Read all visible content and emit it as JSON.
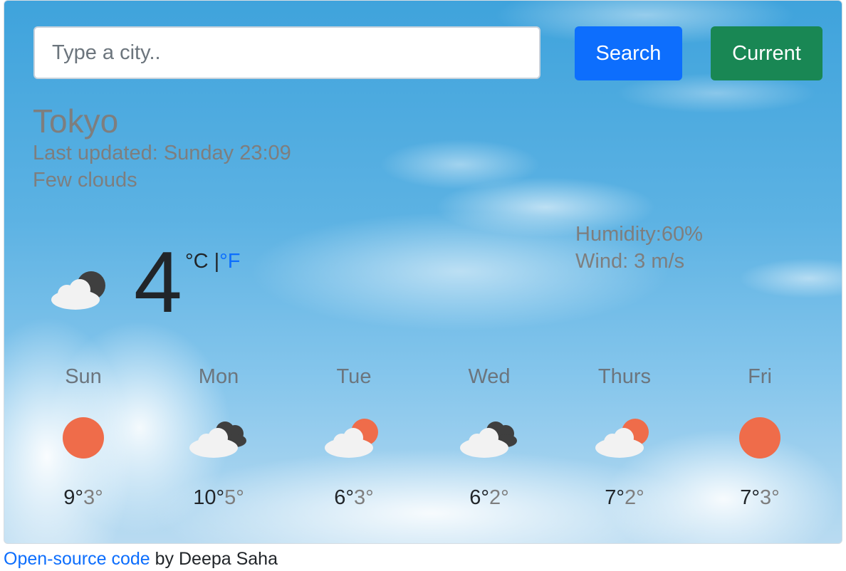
{
  "search": {
    "placeholder": "Type a city..",
    "value": "",
    "search_label": "Search",
    "current_label": "Current"
  },
  "current": {
    "city": "Tokyo",
    "last_updated": "Last updated: Sunday 23:09",
    "description": "Few clouds",
    "temperature": "4",
    "unit_celsius": "°C |",
    "unit_fahrenheit": "°F",
    "humidity": "Humidity:60%",
    "wind": "Wind: 3 m/s",
    "icon": "few-clouds-night-icon"
  },
  "forecast": [
    {
      "day": "Sun",
      "max": "9°",
      "min": "3°",
      "icon": "sun-icon"
    },
    {
      "day": "Mon",
      "max": "10°",
      "min": "5°",
      "icon": "dark-clouds-icon"
    },
    {
      "day": "Tue",
      "max": "6°",
      "min": "3°",
      "icon": "cloud-sun-icon"
    },
    {
      "day": "Wed",
      "max": "6°",
      "min": "2°",
      "icon": "dark-clouds-icon"
    },
    {
      "day": "Thurs",
      "max": "7°",
      "min": "2°",
      "icon": "cloud-sun-icon"
    },
    {
      "day": "Fri",
      "max": "7°",
      "min": "3°",
      "icon": "sun-icon"
    }
  ],
  "footer": {
    "link_text": "Open-source code",
    "author_text": " by Deepa Saha"
  },
  "colors": {
    "search_button": "#0d6efd",
    "current_button": "#198754",
    "sun": "#ef6c4a",
    "cloud": "#f2f2f2",
    "dark_cloud": "#3f3f3f"
  }
}
